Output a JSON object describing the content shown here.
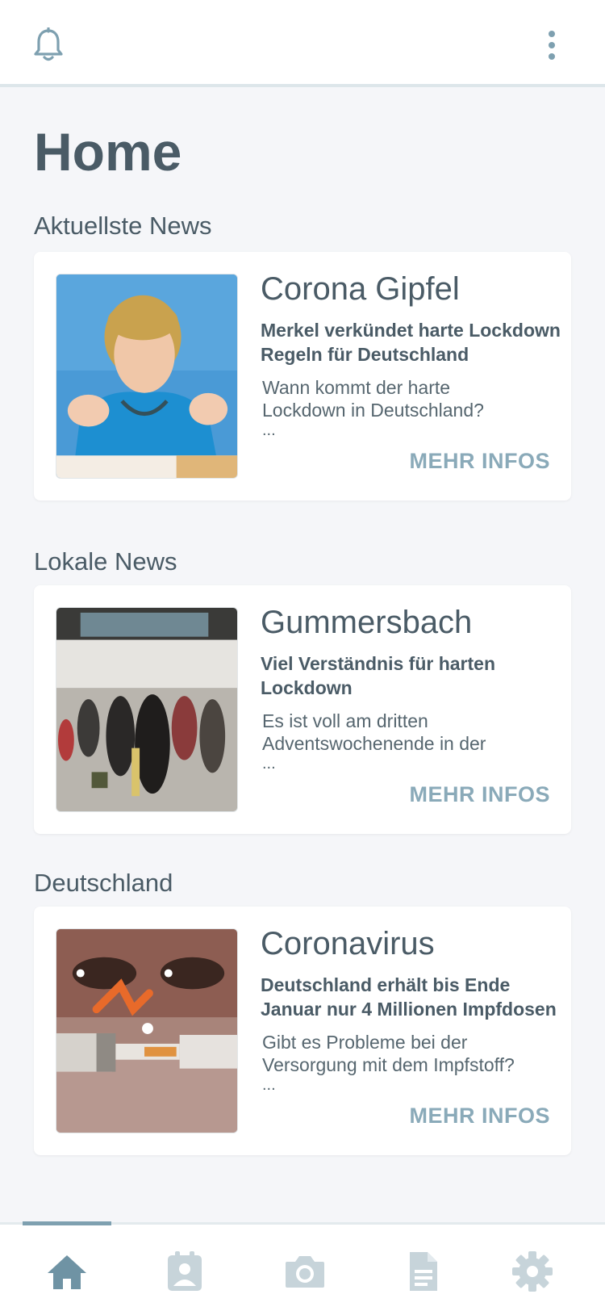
{
  "colors": {
    "accent": "#8aaab9",
    "text": "#4a5b66",
    "icon_inactive": "#c7d4da",
    "icon_active": "#6f93a4",
    "background": "#f5f6f9"
  },
  "topbar": {
    "left_icon": "bell-icon",
    "right_icon": "more-vertical-icon"
  },
  "page": {
    "title": "Home"
  },
  "sections": [
    {
      "title": "Aktuellste News",
      "card": {
        "image": "merkel-press-conference-photo",
        "title": "Corona Gipfel",
        "subtitle": "Merkel verkündet harte Lockdown Regeln für Deutschland",
        "excerpt": "Wann kommt der harte Lockdown in Deutschland?",
        "ellipsis": "...",
        "button": "MEHR INFOS"
      }
    },
    {
      "title": "Lokale News",
      "card": {
        "image": "crowded-shopping-street-photo",
        "title": "Gummersbach",
        "subtitle": "Viel Verständnis für harten Lockdown",
        "excerpt": "Es ist voll am dritten Adventswochenende in der",
        "ellipsis": "...",
        "button": "MEHR INFOS"
      }
    },
    {
      "title": "Deutschland",
      "card": {
        "image": "vaccine-syringe-photo",
        "title": "Coronavirus",
        "subtitle": "Deutschland erhält bis Ende Januar nur 4 Millionen Impfdosen",
        "excerpt": "Gibt es Probleme bei der Versorgung mit dem Impfstoff?",
        "ellipsis": "...",
        "button": "MEHR INFOS"
      }
    }
  ],
  "bottom_nav": {
    "active_index": 0,
    "items": [
      {
        "icon": "home-icon"
      },
      {
        "icon": "contact-card-icon"
      },
      {
        "icon": "camera-icon"
      },
      {
        "icon": "document-icon"
      },
      {
        "icon": "gear-icon"
      }
    ]
  }
}
